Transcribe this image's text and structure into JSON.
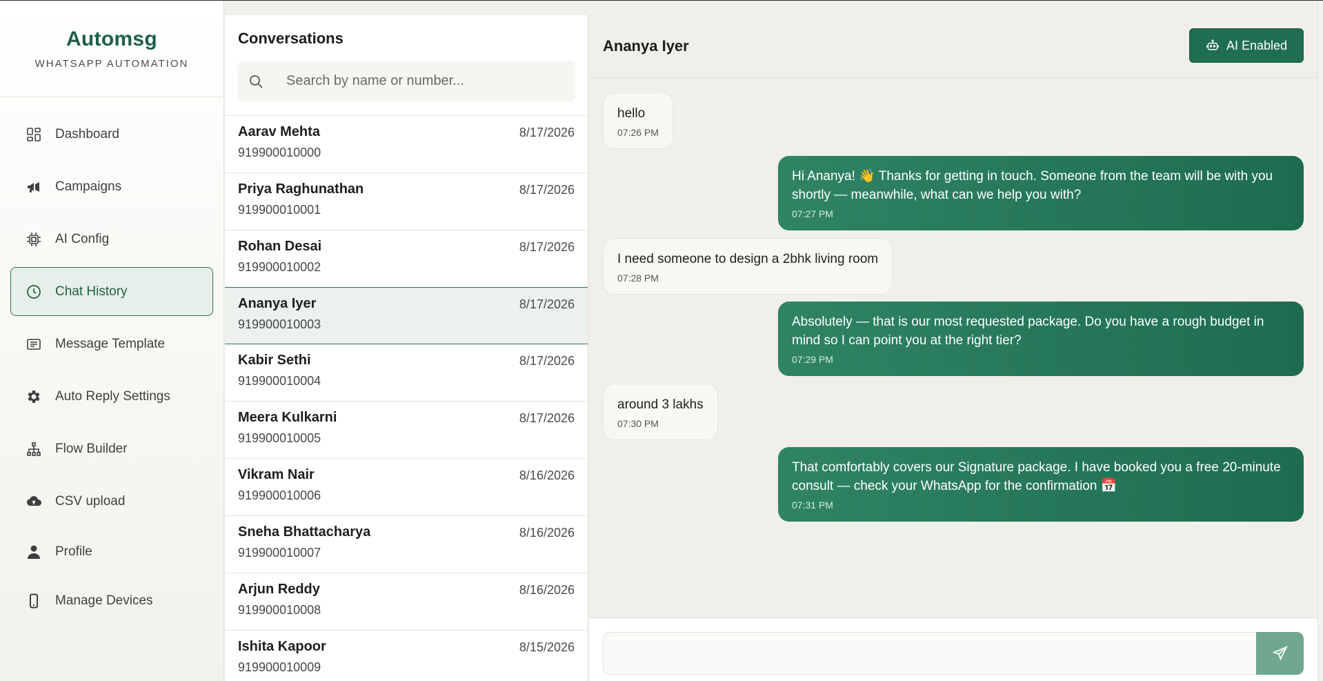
{
  "brand": {
    "name": "Automsg",
    "subtitle": "WHATSAPP AUTOMATION"
  },
  "sidebar": {
    "items": [
      {
        "label": "Dashboard",
        "icon": "dashboard-icon"
      },
      {
        "label": "Campaigns",
        "icon": "megaphone-icon"
      },
      {
        "label": "AI Config",
        "icon": "chip-icon"
      },
      {
        "label": "Chat History",
        "icon": "clock-icon",
        "active": true
      },
      {
        "label": "Message Template",
        "icon": "template-icon"
      },
      {
        "label": "Auto Reply Settings",
        "icon": "gear-icon"
      },
      {
        "label": "Flow Builder",
        "icon": "flow-icon"
      },
      {
        "label": "CSV upload",
        "icon": "cloud-upload-icon"
      },
      {
        "label": "Profile",
        "icon": "user-icon"
      },
      {
        "label": "Manage Devices",
        "icon": "phone-icon"
      }
    ]
  },
  "conversations": {
    "title": "Conversations",
    "search_placeholder": "Search by name or number...",
    "items": [
      {
        "name": "Aarav Mehta",
        "number": "919900010000",
        "date": "8/17/2026"
      },
      {
        "name": "Priya Raghunathan",
        "number": "919900010001",
        "date": "8/17/2026"
      },
      {
        "name": "Rohan Desai",
        "number": "919900010002",
        "date": "8/17/2026"
      },
      {
        "name": "Ananya Iyer",
        "number": "919900010003",
        "date": "8/17/2026",
        "active": true
      },
      {
        "name": "Kabir Sethi",
        "number": "919900010004",
        "date": "8/17/2026"
      },
      {
        "name": "Meera Kulkarni",
        "number": "919900010005",
        "date": "8/17/2026"
      },
      {
        "name": "Vikram Nair",
        "number": "919900010006",
        "date": "8/16/2026"
      },
      {
        "name": "Sneha Bhattacharya",
        "number": "919900010007",
        "date": "8/16/2026"
      },
      {
        "name": "Arjun Reddy",
        "number": "919900010008",
        "date": "8/16/2026"
      },
      {
        "name": "Ishita Kapoor",
        "number": "919900010009",
        "date": "8/15/2026"
      }
    ]
  },
  "chat": {
    "contact_name": "Ananya Iyer",
    "ai_button_label": "AI Enabled",
    "messages": [
      {
        "dir": "in",
        "text": "hello",
        "time": "07:26 PM"
      },
      {
        "dir": "out",
        "text": "Hi Ananya! 👋 Thanks for getting in touch. Someone from the team will be with you shortly — meanwhile, what can we help you with?",
        "time": "07:27 PM"
      },
      {
        "dir": "in",
        "text": "I need someone to design a 2bhk living room",
        "time": "07:28 PM"
      },
      {
        "dir": "out",
        "text": "Absolutely — that is our most requested package. Do you have a rough budget in mind so I can point you at the right tier?",
        "time": "07:29 PM"
      },
      {
        "dir": "in",
        "text": "around 3 lakhs",
        "time": "07:30 PM"
      },
      {
        "dir": "out",
        "text": "That comfortably covers our Signature package. I have booked you a free 20-minute consult — check your WhatsApp for the confirmation 📅",
        "time": "07:31 PM"
      }
    ],
    "composer_value": ""
  },
  "colors": {
    "brand": "#1f5f46",
    "accent": "#1f6e52",
    "outgoing_bubble": "#2f8464",
    "send_button": "#6fa88f"
  }
}
